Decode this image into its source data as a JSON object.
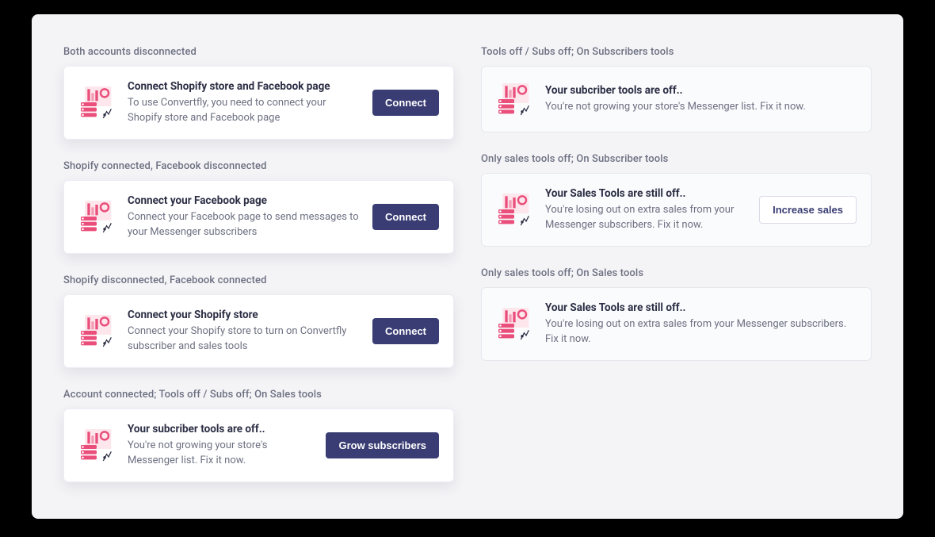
{
  "left": [
    {
      "label": "Both accounts disconnected",
      "title": "Connect Shopify store and Facebook page",
      "desc": "To use Convertfly, you need to connect your Shopify store and Facebook page",
      "button": "Connect",
      "button_style": "primary",
      "shadow": true
    },
    {
      "label": "Shopify connected, Facebook disconnected",
      "title": "Connect your Facebook page",
      "desc": "Connect your Facebook page to send messages to your Messenger subscribers",
      "button": "Connect",
      "button_style": "primary",
      "shadow": true
    },
    {
      "label": "Shopify disconnected, Facebook connected",
      "title": "Connect your Shopify store",
      "desc": "Connect your Shopify store to turn on Convertfly subscriber and sales tools",
      "button": "Connect",
      "button_style": "primary",
      "shadow": true
    },
    {
      "label": "Account connected; Tools off / Subs off; On Sales tools",
      "title": "Your subcriber tools are off..",
      "desc": "You're not growing your store's Messenger list. Fix it now.",
      "button": "Grow subscribers",
      "button_style": "primary",
      "shadow": true
    }
  ],
  "right": [
    {
      "label": "Tools off / Subs off; On Subscribers tools",
      "title": "Your subcriber tools are off..",
      "desc": "You're not growing your store's Messenger list. Fix it now.",
      "button": null,
      "muted": true
    },
    {
      "label": "Only sales tools off; On Subscriber tools",
      "title": "Your Sales Tools are still off..",
      "desc": "You're losing out on extra sales from your Messenger subscribers. Fix it now.",
      "button": "Increase sales",
      "button_style": "outline",
      "muted": true
    },
    {
      "label": "Only sales tools off; On Sales tools",
      "title": "Your Sales Tools are still off..",
      "desc": "You're losing out on extra sales from your Messenger subscribers. Fix it now.",
      "button": null,
      "muted": true
    }
  ]
}
